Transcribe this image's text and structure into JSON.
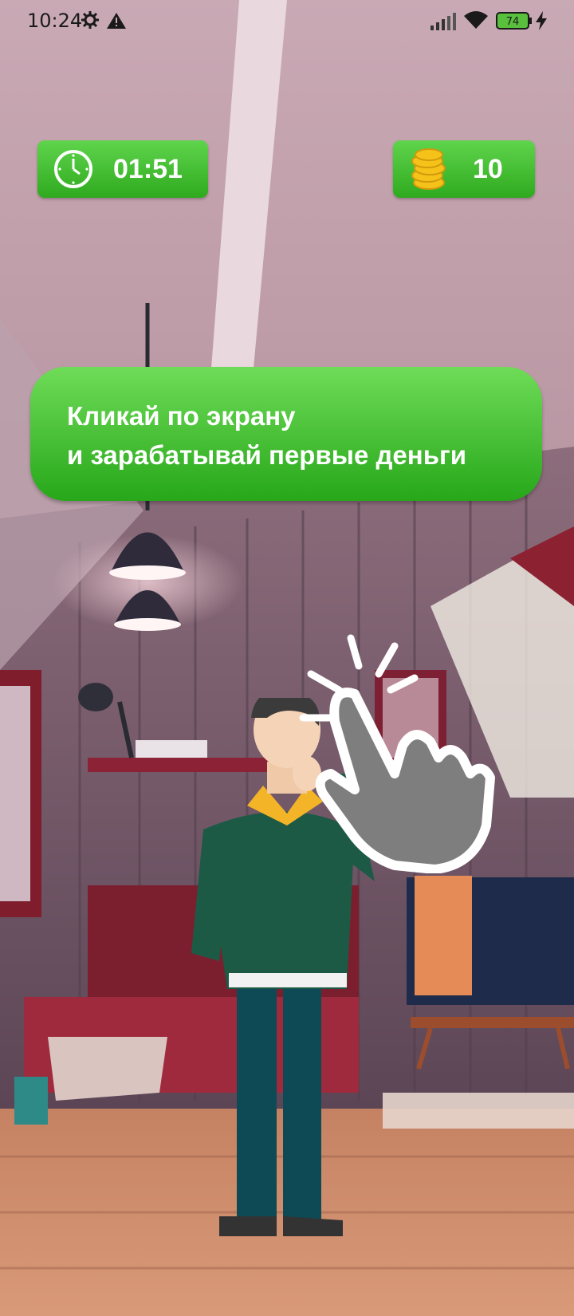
{
  "status_bar": {
    "time": "10:24",
    "battery_level": "74",
    "icons": [
      "settings-gear-icon",
      "warning-icon",
      "signal-icon",
      "wifi-icon",
      "battery-icon",
      "charging-icon"
    ]
  },
  "hud": {
    "timer": {
      "icon": "clock-icon",
      "value": "01:51"
    },
    "coins": {
      "icon": "coin-stack-icon",
      "value": "10"
    }
  },
  "tutorial": {
    "line1": "Кликай по экрану",
    "line2": "и зарабатывай первые деньги"
  },
  "scene": {
    "background": "messy-attic-room",
    "character": "thinking-man",
    "hint_icon": "tap-hand-icon"
  },
  "colors": {
    "accent_green": "#3cbf2c",
    "text_white": "#ffffff"
  }
}
